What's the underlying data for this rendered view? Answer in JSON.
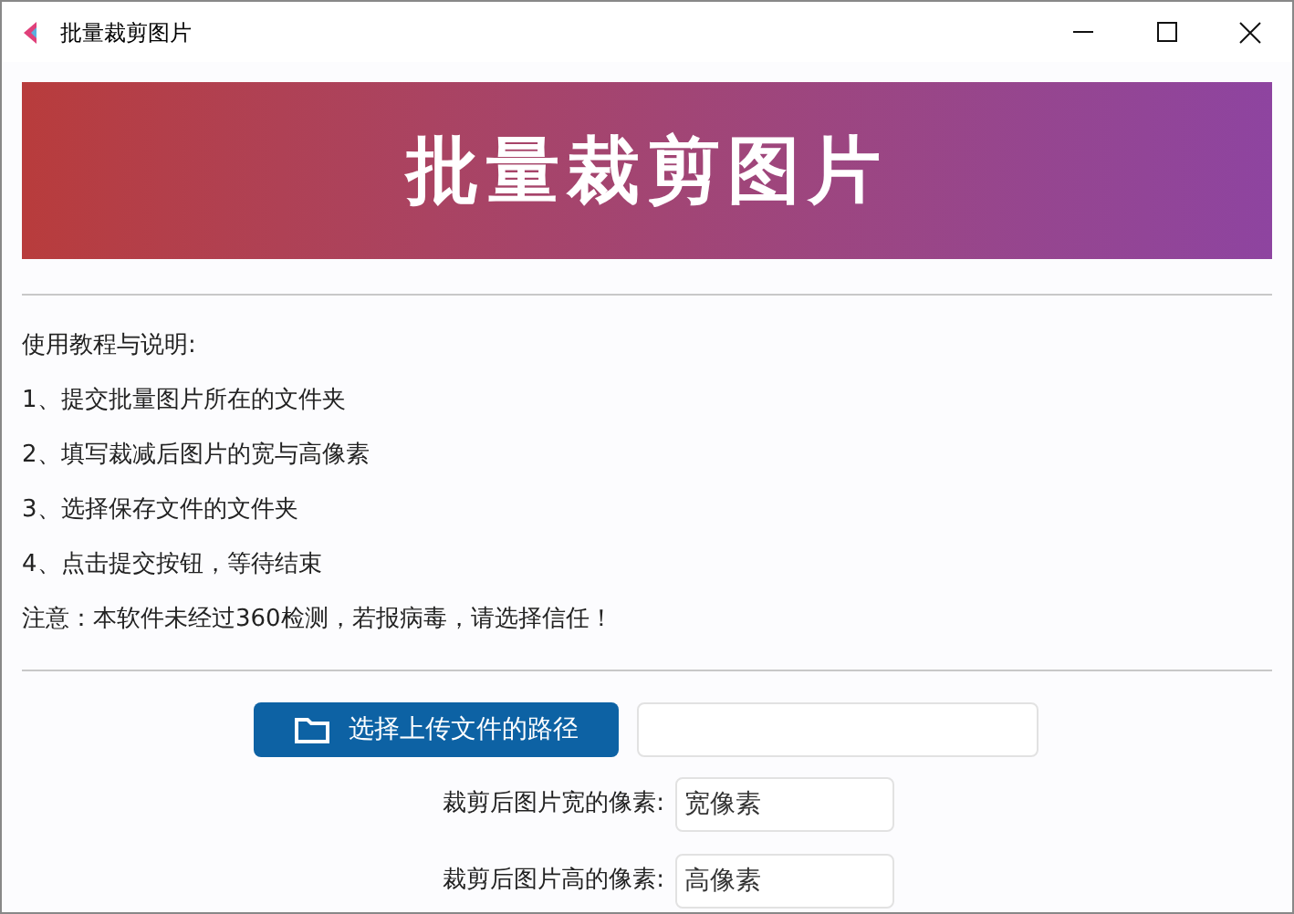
{
  "window": {
    "title": "批量裁剪图片"
  },
  "banner": {
    "title": "批量裁剪图片"
  },
  "instructions": [
    "使用教程与说明:",
    "1、提交批量图片所在的文件夹",
    "2、填写裁减后图片的宽与高像素",
    "3、选择保存文件的文件夹",
    "4、点击提交按钮，等待结束",
    "注意：本软件未经过360检测，若报病毒，请选择信任！"
  ],
  "upload": {
    "button": "选择上传文件的路径"
  },
  "fields": [
    {
      "label": "裁剪后图片宽的像素:",
      "placeholder": "宽像素"
    },
    {
      "label": "裁剪后图片高的像素:",
      "placeholder": "高像素"
    }
  ]
}
